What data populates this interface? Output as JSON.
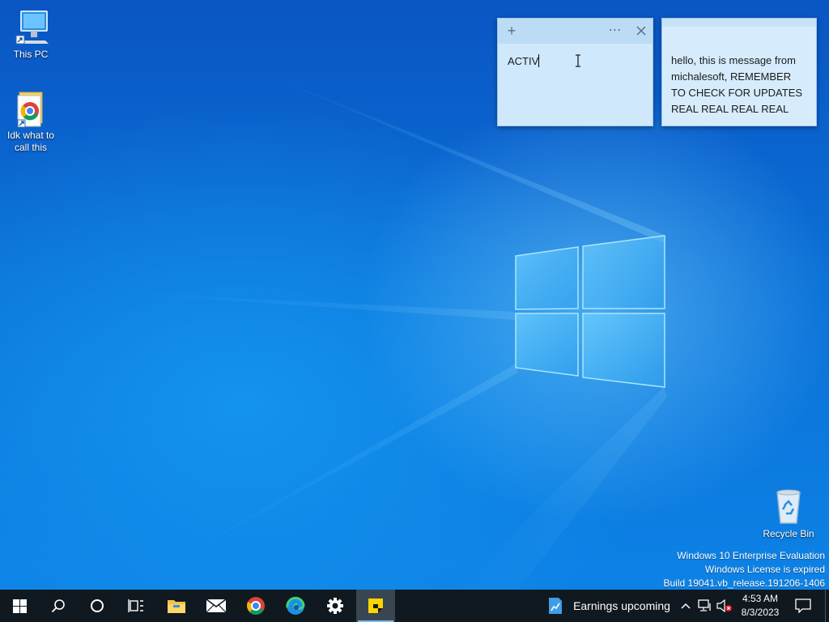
{
  "desktop": {
    "icons": [
      {
        "label": "This PC",
        "icon": "computer-icon"
      },
      {
        "label": "Idk what to call this",
        "icon": "chrome-shortcut-icon"
      },
      {
        "label": "Recycle Bin",
        "icon": "recycle-bin-icon"
      }
    ],
    "watermark": {
      "line1": "Windows 10 Enterprise Evaluation",
      "line2": "Windows License is expired",
      "line3": "Build 19041.vb_release.191206-1406"
    }
  },
  "sticky_notes": [
    {
      "text": "ACTIV"
    },
    {
      "text": "hello, this is message from michalesoft, REMEMBER TO CHECK FOR UPDATES REAL REAL REAL REAL"
    }
  ],
  "taskbar": {
    "pinned": [
      {
        "name": "start-button",
        "icon": "windows-logo-icon"
      },
      {
        "name": "search-button",
        "icon": "search-icon"
      },
      {
        "name": "cortana-button",
        "icon": "cortana-circle-icon"
      },
      {
        "name": "task-view-button",
        "icon": "task-view-icon"
      },
      {
        "name": "file-explorer-button",
        "icon": "folder-icon"
      },
      {
        "name": "mail-button",
        "icon": "mail-icon"
      },
      {
        "name": "chrome-button",
        "icon": "chrome-icon"
      },
      {
        "name": "edge-button",
        "icon": "edge-icon"
      },
      {
        "name": "settings-button",
        "icon": "gear-icon"
      },
      {
        "name": "sticky-notes-button",
        "icon": "sticky-notes-icon"
      }
    ],
    "news_widget": "Earnings upcoming",
    "clock": {
      "time": "4:53 AM",
      "date": "8/3/2023"
    }
  },
  "colors": {
    "note_bg": "#cfe8fb",
    "taskbar_bg": "#101820",
    "accent": "#76b9ed"
  }
}
